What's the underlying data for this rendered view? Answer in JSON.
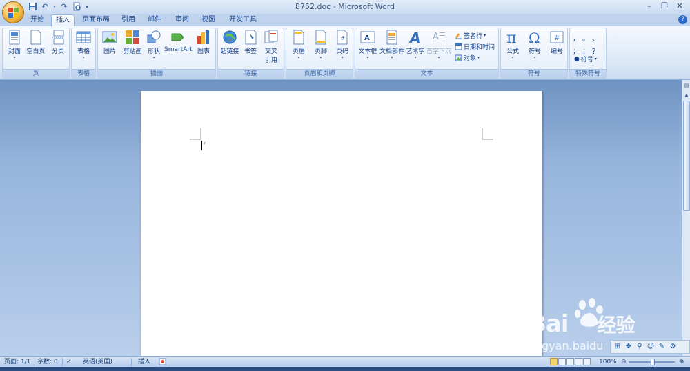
{
  "window": {
    "title": "8752.doc - Microsoft Word"
  },
  "tabs": [
    "开始",
    "插入",
    "页面布局",
    "引用",
    "邮件",
    "审阅",
    "视图",
    "开发工具"
  ],
  "active_tab": "插入",
  "ribbon": {
    "groups": {
      "pages": {
        "label": "页",
        "buttons": [
          "封面",
          "空白页",
          "分页"
        ]
      },
      "tables": {
        "label": "表格",
        "buttons": [
          "表格"
        ]
      },
      "illustrations": {
        "label": "插图",
        "buttons": [
          "图片",
          "剪贴画",
          "形状",
          "SmartArt",
          "图表"
        ]
      },
      "links": {
        "label": "链接",
        "buttons": [
          "超链接",
          "书签",
          "交叉",
          "引用"
        ]
      },
      "header_footer": {
        "label": "页眉和页脚",
        "buttons": [
          "页眉",
          "页脚",
          "页码"
        ]
      },
      "text": {
        "label": "文本",
        "buttons": [
          "文本框",
          "文档部件",
          "艺术字",
          "首字下沉"
        ],
        "small": [
          "签名行",
          "日期和时间",
          "对象"
        ]
      },
      "symbols": {
        "label": "符号",
        "buttons": [
          "公式",
          "符号",
          "编号"
        ]
      },
      "special": {
        "label": "特殊符号",
        "symbol_button": "符号",
        "glyphs": [
          "，",
          "。",
          "、",
          "；",
          "：",
          "？"
        ]
      }
    }
  },
  "status": {
    "page": "页面: 1/1",
    "words": "字数: 0",
    "language": "英语(美国)",
    "mode": "插入",
    "zoom": "100%"
  },
  "watermark": {
    "brand": "Bai",
    "brand2": "经验",
    "url": "jingyan.baidu"
  },
  "colors": {
    "ribbon_text": "#15428b",
    "doc_bg": "#96b4dc",
    "accent_orange": "#f3b640"
  }
}
